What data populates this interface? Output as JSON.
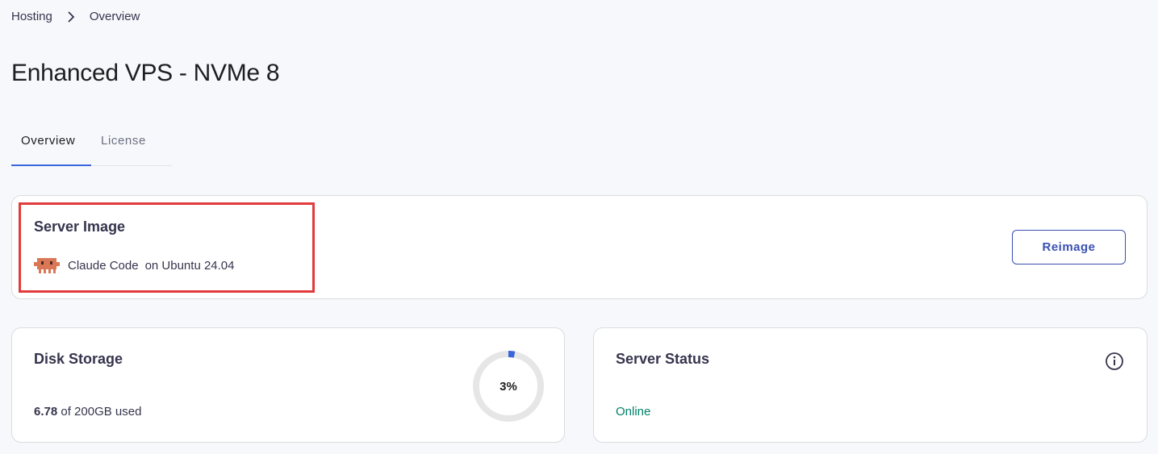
{
  "breadcrumb": {
    "items": [
      "Hosting",
      "Overview"
    ],
    "separator_icon": "chevron-right-icon"
  },
  "page": {
    "title": "Enhanced VPS - NVMe 8"
  },
  "tabs": [
    {
      "label": "Overview",
      "active": true
    },
    {
      "label": "License",
      "active": false
    }
  ],
  "server_image": {
    "title": "Server Image",
    "icon": "claude-robot-icon",
    "name": "Claude Code",
    "os": "on Ubuntu 24.04",
    "action_label": "Reimage"
  },
  "disk_storage": {
    "title": "Disk Storage",
    "used": "6.78",
    "total_text": "of 200GB used",
    "percent_label": "3%",
    "percent_value": 3
  },
  "server_status": {
    "title": "Server Status",
    "status": "Online",
    "info_icon": "info-icon"
  },
  "colors": {
    "accent": "#3a66db",
    "button_border": "#3a4fb3",
    "status_online": "#00806a",
    "highlight": "#e23b3b",
    "robot_icon": "#d97757",
    "donut_track": "#e6e6e6"
  }
}
